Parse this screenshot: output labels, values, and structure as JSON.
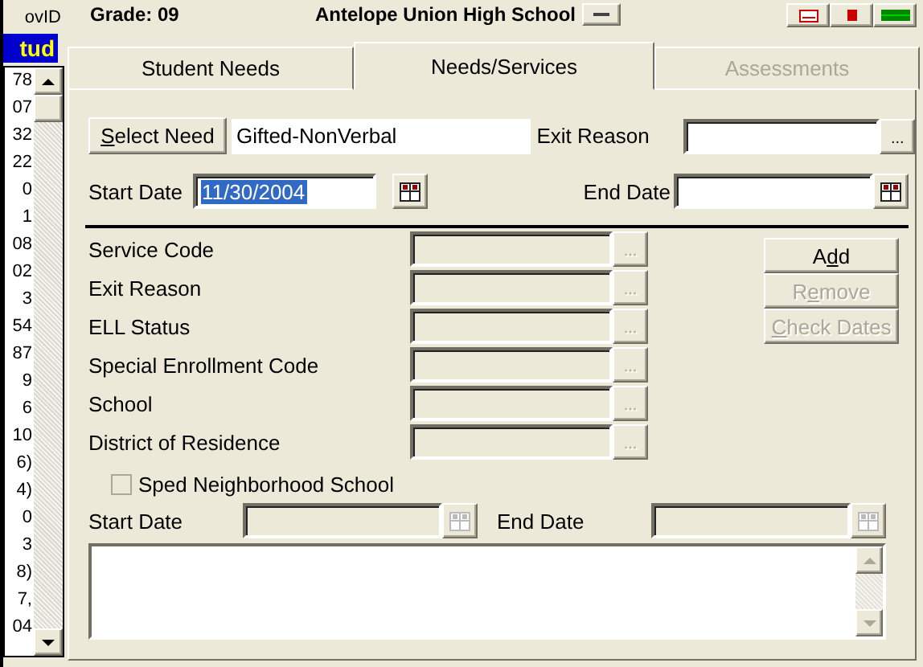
{
  "header": {
    "grade": "Grade: 09",
    "school": "Antelope Union High School"
  },
  "student_list": {
    "column_header": "ovID",
    "title": "tud",
    "rows": [
      "78",
      "07",
      "32",
      "22",
      "0",
      "1",
      "08",
      "02",
      "3",
      "54",
      "87",
      "9",
      "6",
      "10",
      "6)",
      "4)",
      "0",
      "3",
      "8)",
      "7,",
      "04"
    ]
  },
  "tabs": [
    {
      "label": "Student Needs",
      "selected": false,
      "disabled": false
    },
    {
      "label": "Needs/Services",
      "selected": true,
      "disabled": false
    },
    {
      "label": "Assessments",
      "selected": false,
      "disabled": true
    }
  ],
  "need": {
    "select_button": {
      "key": "S",
      "post": "elect Need"
    },
    "value": "Gifted-NonVerbal",
    "exit_reason_label": "Exit Reason",
    "exit_reason_browse": "...",
    "start_date_label": "Start Date",
    "start_date": "11/30/2004",
    "start_date_highlighted": true,
    "end_date_label": "End Date"
  },
  "services": {
    "fields": [
      {
        "label": "Service Code",
        "browse": "...",
        "disabled": true
      },
      {
        "label": "Exit Reason",
        "browse": "...",
        "disabled": true
      },
      {
        "label": "ELL Status",
        "browse": "...",
        "disabled": true
      },
      {
        "label": "Special Enrollment Code",
        "browse": "...",
        "disabled": true
      },
      {
        "label": "School",
        "browse": "...",
        "disabled": true
      },
      {
        "label": "District of Residence",
        "browse": "...",
        "disabled": true
      }
    ],
    "buttons": [
      {
        "pre": "A",
        "key": "d",
        "post": "d",
        "disabled": false
      },
      {
        "pre": "R",
        "key": "e",
        "post": "move",
        "disabled": true
      },
      {
        "key": "C",
        "post": "heck Dates",
        "disabled": true
      }
    ],
    "checkbox": {
      "label": "Sped Neighborhood School",
      "checked": false,
      "disabled": true
    },
    "start_date_label": "Start Date",
    "end_date_label": "End Date",
    "dates_disabled": true
  }
}
